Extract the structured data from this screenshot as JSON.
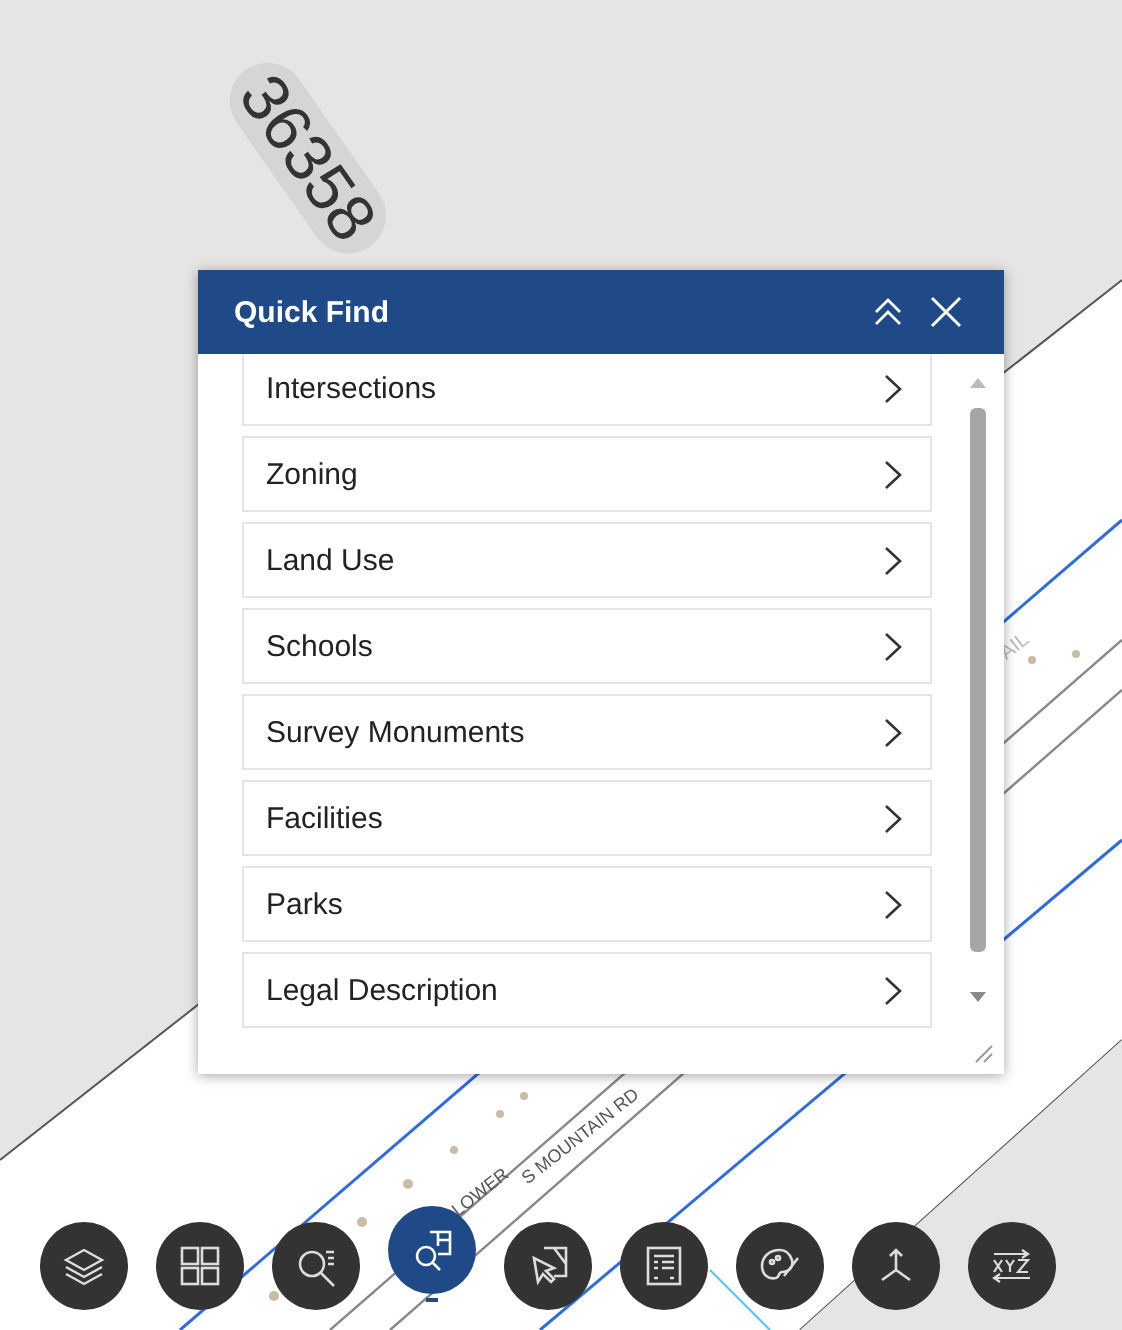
{
  "map": {
    "labels": [
      {
        "kind": "parcel",
        "text": "36358"
      },
      {
        "kind": "road",
        "text": "AIL"
      },
      {
        "kind": "road-low",
        "text": "LOWER"
      },
      {
        "kind": "road-mid",
        "text": "S MOUNTAIN RD"
      }
    ]
  },
  "panel": {
    "title": "Quick Find",
    "items": [
      {
        "label": "Intersections"
      },
      {
        "label": "Zoning"
      },
      {
        "label": "Land Use"
      },
      {
        "label": "Schools"
      },
      {
        "label": "Survey Monuments"
      },
      {
        "label": "Facilities"
      },
      {
        "label": "Parks"
      },
      {
        "label": "Legal Description"
      }
    ]
  },
  "toolbar": [
    {
      "kind": "layers",
      "selected": false
    },
    {
      "kind": "grid",
      "selected": false
    },
    {
      "kind": "search-list",
      "selected": false
    },
    {
      "kind": "quick-find",
      "selected": true
    },
    {
      "kind": "select",
      "selected": false
    },
    {
      "kind": "report",
      "selected": false
    },
    {
      "kind": "palette",
      "selected": false
    },
    {
      "kind": "axes",
      "selected": false
    },
    {
      "kind": "xyz",
      "selected": false
    }
  ]
}
